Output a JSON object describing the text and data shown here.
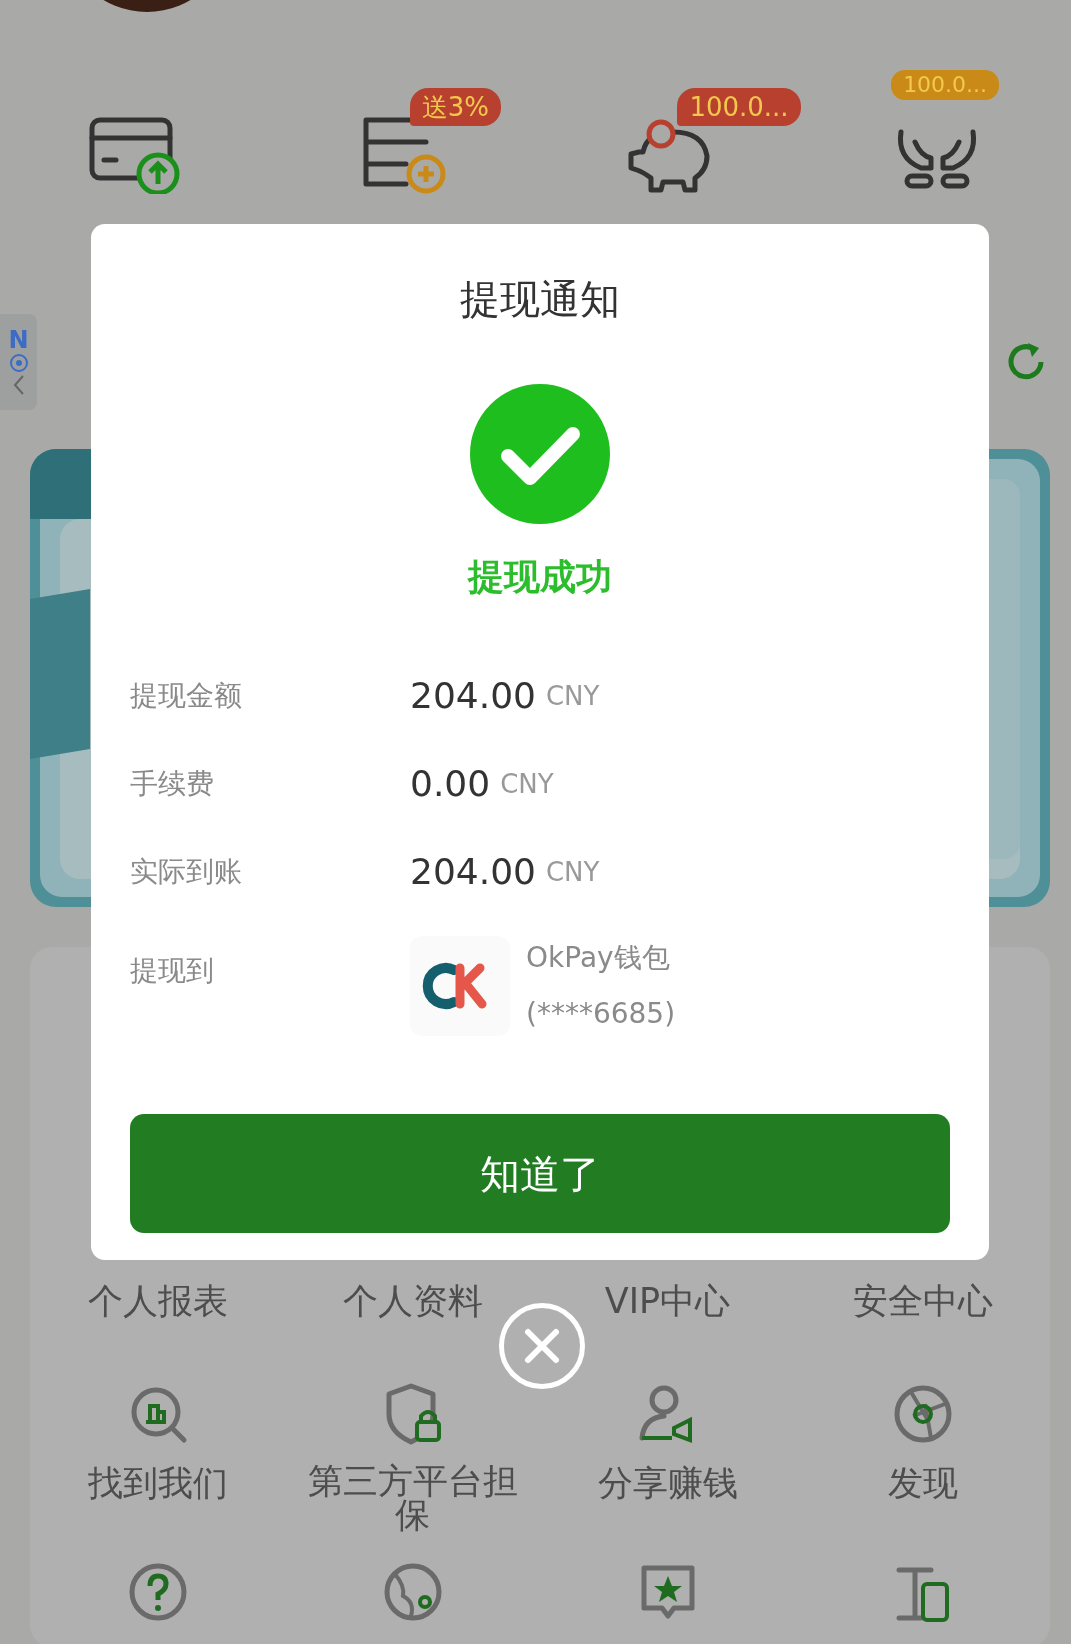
{
  "quick_actions": [
    {
      "kind": "card-withdraw"
    },
    {
      "kind": "deposit",
      "badge": {
        "text": "送3%",
        "color": "#b8402f"
      }
    },
    {
      "kind": "piggy",
      "badge": {
        "text": "100.0...",
        "color": "#b8402f"
      }
    },
    {
      "kind": "hands",
      "badge": {
        "text": "100.0...",
        "color": "#c98a17"
      }
    }
  ],
  "side_tab": {
    "text": "N"
  },
  "menu": [
    {
      "label": "个人报表"
    },
    {
      "label": "个人资料"
    },
    {
      "label": "VIP中心"
    },
    {
      "label": "安全中心"
    },
    {
      "kind": "search-building",
      "label": "找到我们"
    },
    {
      "kind": "shield-lock",
      "label": "第三方平台担保"
    },
    {
      "kind": "person-megaphone",
      "label": "分享赚钱"
    },
    {
      "kind": "aperture",
      "label": "发现"
    },
    {
      "kind": "question"
    },
    {
      "kind": "globe"
    },
    {
      "kind": "star-chat"
    },
    {
      "kind": "phone"
    }
  ],
  "dialog": {
    "title": "提现通知",
    "status": "提现成功",
    "details": [
      {
        "label": "提现金额",
        "value": "204.00",
        "unit": "CNY"
      },
      {
        "label": "手续费",
        "value": "0.00",
        "unit": "CNY"
      },
      {
        "label": "实际到账",
        "value": "204.00",
        "unit": "CNY"
      }
    ],
    "destination": {
      "label": "提现到",
      "name": "OkPay钱包",
      "account": "(****6685)"
    },
    "button": "知道了"
  }
}
